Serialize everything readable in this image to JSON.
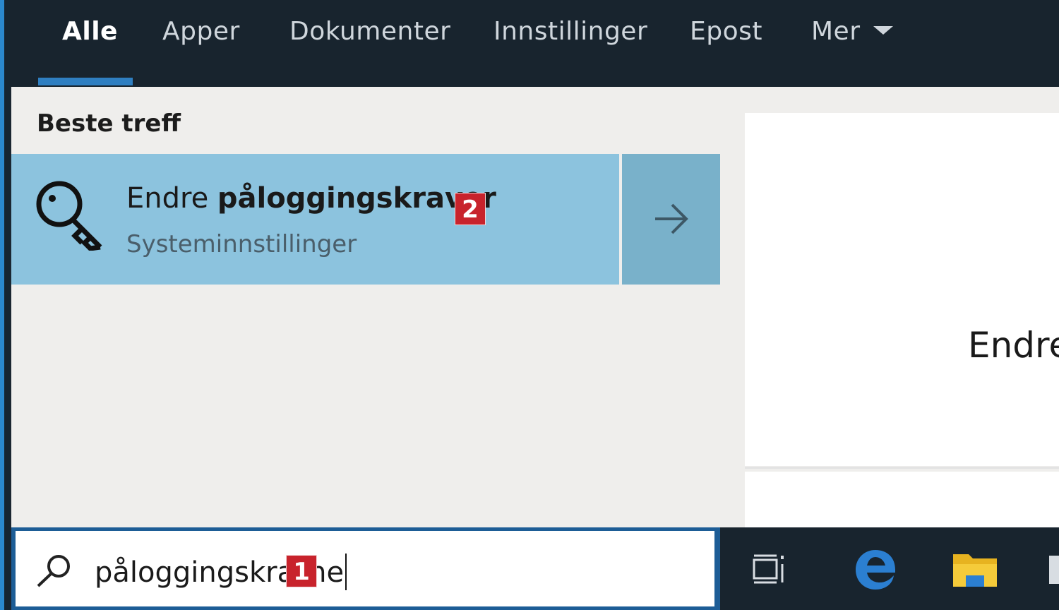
{
  "nav": {
    "tabs": [
      {
        "label": "Alle",
        "active": true
      },
      {
        "label": "Apper",
        "active": false
      },
      {
        "label": "Dokumenter",
        "active": false
      },
      {
        "label": "Innstillinger",
        "active": false
      },
      {
        "label": "Epost",
        "active": false
      },
      {
        "label": "Mer",
        "active": false
      }
    ]
  },
  "results": {
    "section_title": "Beste treff",
    "best_match": {
      "title_prefix": "Endre ",
      "title_bold": "påloggingskraver",
      "subtitle": "Systeminnstillinger",
      "icon": "key-icon",
      "badge": "2"
    }
  },
  "preview": {
    "title": "Endre"
  },
  "search": {
    "value_before": "påloggingskra",
    "badge": "1",
    "value_after": "ne",
    "icon": "search-icon"
  },
  "taskbar": {
    "icons": [
      "task-view-icon",
      "edge-icon",
      "file-explorer-icon"
    ]
  },
  "colors": {
    "nav_bg": "#18242e",
    "accent": "#2f7fc1",
    "selected_row": "#8cc3de",
    "badge": "#c8232c"
  }
}
